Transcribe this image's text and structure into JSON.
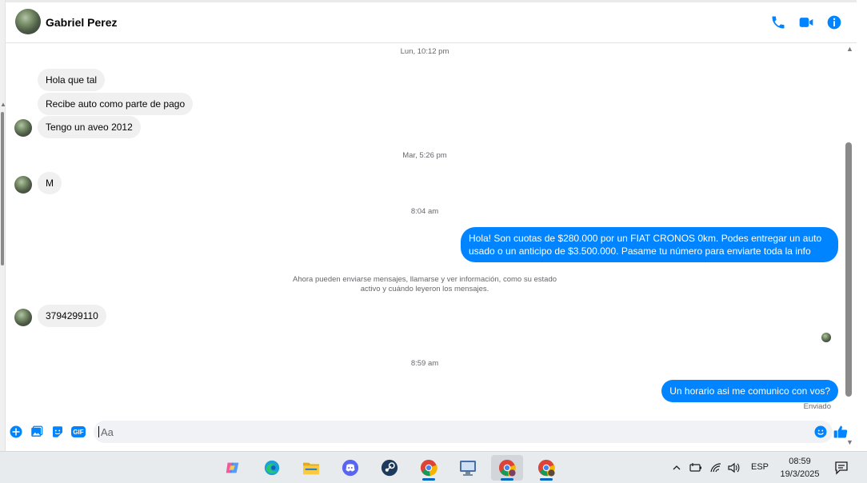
{
  "header": {
    "contact_name": "Gabriel Perez",
    "call_icon": "phone-icon",
    "video_icon": "video-icon",
    "info_icon": "info-icon",
    "accent_color": "#0084ff"
  },
  "thread": {
    "stamps": [
      "Lun, 10:12 pm",
      "Mar, 5:26 pm",
      "8:04 am",
      "8:59 am"
    ],
    "incoming": [
      "Hola que tal",
      "Recibe auto como parte de pago",
      "Tengo un aveo 2012",
      "M",
      "3794299110"
    ],
    "outgoing": [
      "Hola! Son cuotas de $280.000 por un FIAT CRONOS 0km. Podes entregar un auto usado o un anticipo de $3.500.000. Pasame tu número para enviarte toda la info",
      "Un horario asi me comunico con vos?"
    ],
    "notice_line1": "Ahora pueden enviarse mensajes, llamarse y ver información, como su estado",
    "notice_line2": "activo y cuándo leyeron los mensajes.",
    "status": "Enviado"
  },
  "composer": {
    "placeholder": "Aa",
    "gif_label": "GIF"
  },
  "taskbar": {
    "language": "ESP",
    "time": "08:59",
    "date": "19/3/2025"
  }
}
